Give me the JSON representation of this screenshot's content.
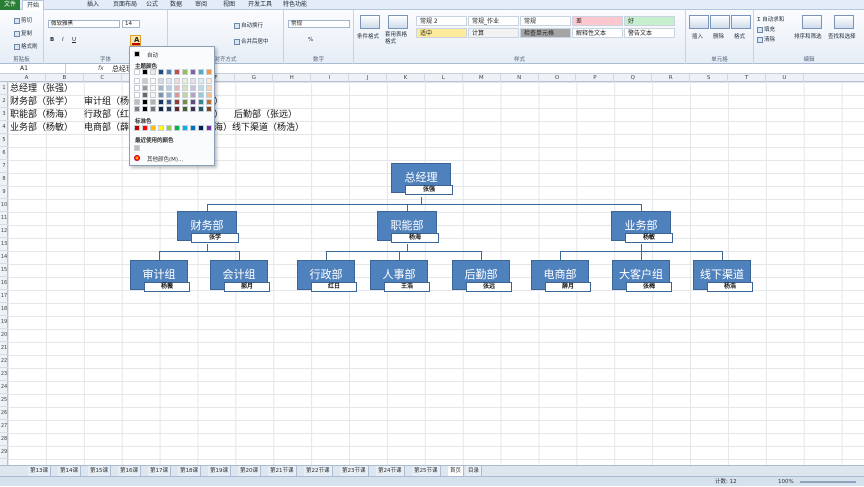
{
  "tabs": [
    "文件",
    "开始",
    "插入",
    "页面布局",
    "公式",
    "数据",
    "审阅",
    "视图",
    "开发工具",
    "特色功能"
  ],
  "ribbon": {
    "clipboard": {
      "cut": "剪切",
      "copy": "复制",
      "format_painter": "格式刷",
      "label": "剪贴板"
    },
    "font": {
      "name": "微软雅黑",
      "size": "14",
      "label": "字体",
      "bold": "B",
      "italic": "I",
      "underline": "U"
    },
    "alignment": {
      "wrap": "自动换行",
      "merge": "合并后居中",
      "label": "对齐方式"
    },
    "number": {
      "format": "常规",
      "label": "数字",
      "percent": "%"
    },
    "styles": {
      "cond_format": "条件格式",
      "table_format": "套用表格格式",
      "cells": [
        {
          "text": "常规 2",
          "bg": "#ffffff"
        },
        {
          "text": "常规_作业",
          "bg": "#ffffff"
        },
        {
          "text": "常规",
          "bg": "#ffffff"
        },
        {
          "text": "差",
          "bg": "#ffc7ce"
        },
        {
          "text": "好",
          "bg": "#c6efce"
        },
        {
          "text": "适中",
          "bg": "#ffeb9c"
        },
        {
          "text": "计算",
          "bg": "#f2f2f2"
        },
        {
          "text": "检查单元格",
          "bg": "#a5a5a5"
        },
        {
          "text": "解释性文本",
          "bg": "#ffffff"
        },
        {
          "text": "警告文本",
          "bg": "#ffffff"
        }
      ],
      "label": "样式"
    },
    "cells": {
      "insert": "插入",
      "delete": "删除",
      "format": "格式",
      "label": "单元格"
    },
    "editing": {
      "autosum": "自动求和",
      "fill": "填充",
      "clear": "清除",
      "sort": "排序和筛选",
      "find": "查找和选择",
      "label": "编辑"
    }
  },
  "formula_bar": {
    "name_box": "A1",
    "fx": "fx",
    "value": "总经理"
  },
  "columns": [
    "A",
    "B",
    "C",
    "D",
    "E",
    "F",
    "G",
    "H",
    "I",
    "J",
    "K",
    "L",
    "M",
    "N",
    "O",
    "P",
    "Q",
    "R",
    "S",
    "T",
    "U"
  ],
  "rows": [
    "1",
    "2",
    "3",
    "4",
    "5",
    "6",
    "7",
    "8",
    "9",
    "10",
    "11",
    "12",
    "13",
    "14",
    "15",
    "16",
    "17",
    "18",
    "19",
    "20",
    "21",
    "22",
    "23",
    "24",
    "25",
    "26",
    "27",
    "28",
    "29"
  ],
  "cells": [
    [
      "总经理（张强）"
    ],
    [
      "财务部（张学）",
      "审计组（杨",
      "）"
    ],
    [
      "职能部（杨海）",
      "行政部（红",
      "）",
      "后勤部（张远）"
    ],
    [
      "业务部（杨敏）",
      "电商部（薛",
      "海）线下渠道（杨浩）"
    ]
  ],
  "org": {
    "root": {
      "title": "总经理",
      "name": "张强"
    },
    "depts": [
      {
        "title": "财务部",
        "name": "张学",
        "children": [
          {
            "title": "审计组",
            "name": "杨薇"
          },
          {
            "title": "会计组",
            "name": "郝月"
          }
        ]
      },
      {
        "title": "职能部",
        "name": "杨海",
        "children": [
          {
            "title": "行政部",
            "name": "红日"
          },
          {
            "title": "人事部",
            "name": "王浩"
          },
          {
            "title": "后勤部",
            "name": "张远"
          }
        ]
      },
      {
        "title": "业务部",
        "name": "杨敏",
        "children": [
          {
            "title": "电商部",
            "name": "薛月"
          },
          {
            "title": "大客户组",
            "name": "张梅"
          },
          {
            "title": "线下渠道",
            "name": "杨浩"
          }
        ]
      }
    ]
  },
  "color_menu": {
    "auto": "自动",
    "theme": "主题颜色",
    "standard": "标准色",
    "recent": "最近使用的颜色",
    "more": "其他颜色(M)...",
    "theme_top": [
      "#ffffff",
      "#000000",
      "#eeece1",
      "#1f497d",
      "#4f81bd",
      "#c0504d",
      "#9bbb59",
      "#8064a2",
      "#4bacc6",
      "#f79646"
    ],
    "standard_colors": [
      "#c00000",
      "#ff0000",
      "#ffc000",
      "#ffff00",
      "#92d050",
      "#00b050",
      "#00b0f0",
      "#0070c0",
      "#002060",
      "#7030a0"
    ]
  },
  "sheets": [
    "第13课",
    "第14课",
    "第15课",
    "第16课",
    "第17课",
    "第18课",
    "第19课",
    "第20课",
    "第21节课",
    "第22节课",
    "第23节课",
    "第24节课",
    "第25节课",
    "首页",
    "目录"
  ],
  "status": {
    "count": "计数: 12",
    "zoom": "100%"
  }
}
